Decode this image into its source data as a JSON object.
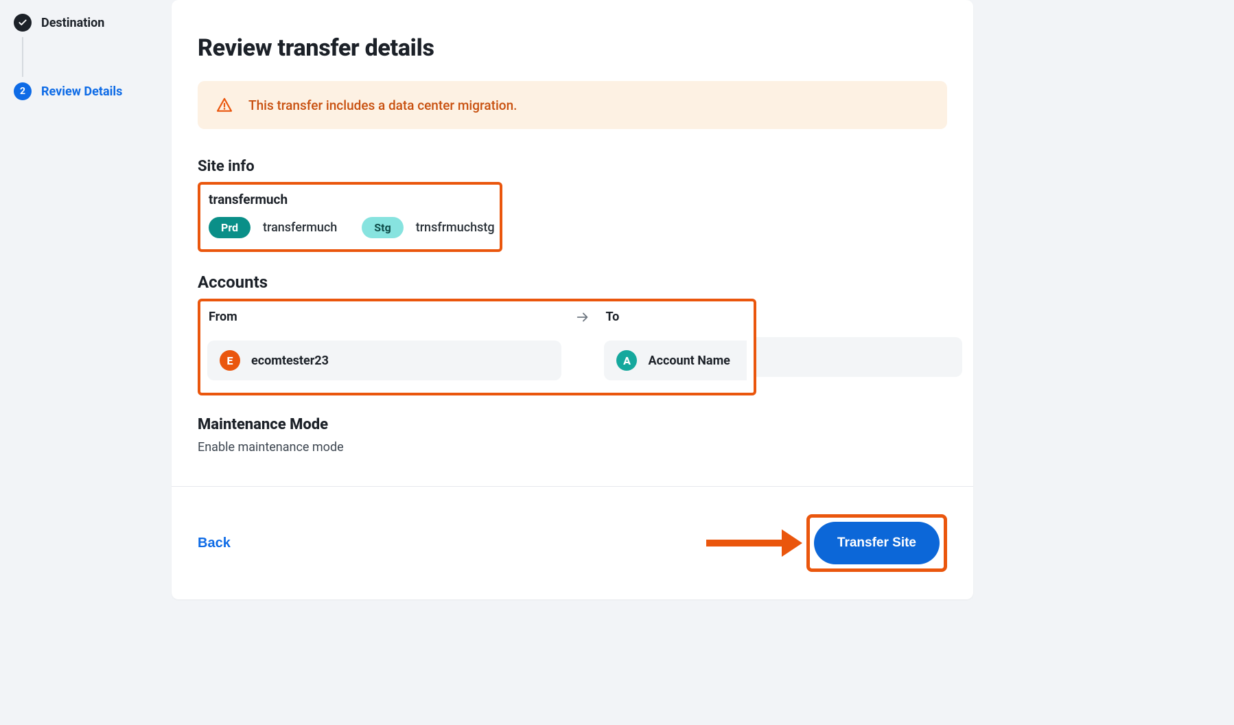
{
  "stepper": {
    "steps": [
      {
        "label": "Destination",
        "state": "done"
      },
      {
        "label": "Review Details",
        "state": "active",
        "number": "2"
      }
    ]
  },
  "page": {
    "title": "Review transfer details",
    "warning": "This transfer includes a data center migration."
  },
  "siteinfo": {
    "heading": "Site info",
    "site_name": "transfermuch",
    "environments": [
      {
        "badge": "Prd",
        "name": "transfermuch"
      },
      {
        "badge": "Stg",
        "name": "trnsfrmuchstg"
      }
    ]
  },
  "accounts": {
    "heading": "Accounts",
    "from_label": "From",
    "to_label": "To",
    "from": {
      "initial": "E",
      "name": "ecomtester23"
    },
    "to": {
      "initial": "A",
      "name": "Account Name"
    }
  },
  "maintenance": {
    "heading": "Maintenance Mode",
    "text": "Enable maintenance mode"
  },
  "footer": {
    "back": "Back",
    "cta": "Transfer Site"
  }
}
